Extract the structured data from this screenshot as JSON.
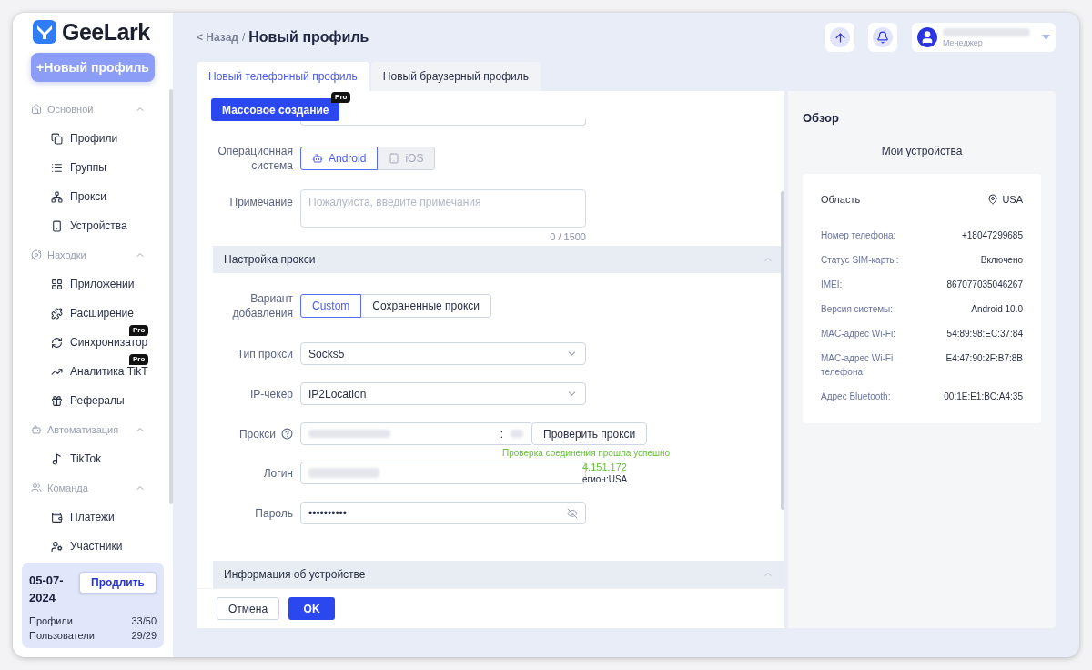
{
  "logo": {
    "text": "GeeLark"
  },
  "new_profile_button": "+Новый профиль",
  "sidebar": {
    "groups": [
      {
        "title": "Основной",
        "expanded": true,
        "items": [
          {
            "label": "Профили"
          },
          {
            "label": "Группы"
          },
          {
            "label": "Прокси"
          },
          {
            "label": "Устройства"
          }
        ]
      },
      {
        "title": "Находки",
        "expanded": true,
        "items": [
          {
            "label": "Приложении"
          },
          {
            "label": "Расширение"
          },
          {
            "label": "Синхронизатор",
            "badge": "Pro"
          },
          {
            "label": "Аналитика TikT",
            "badge": "Pro"
          },
          {
            "label": "Рефералы"
          }
        ]
      },
      {
        "title": "Автоматизация",
        "expanded": true,
        "items": [
          {
            "label": "TikTok"
          }
        ]
      },
      {
        "title": "Команда",
        "expanded": true,
        "items": [
          {
            "label": "Платежи"
          },
          {
            "label": "Участники"
          }
        ]
      }
    ]
  },
  "plan": {
    "date": "05-07-2024",
    "renew_button": "Продлить",
    "stats": [
      {
        "label": "Профили",
        "value": "33/50"
      },
      {
        "label": "Пользователи",
        "value": "29/29"
      }
    ]
  },
  "header": {
    "back": "< Назад",
    "separator": "/",
    "title": "Новый профиль",
    "user_role": "Менеджер"
  },
  "tabs": [
    {
      "label": "Новый телефонный профиль",
      "selected": true
    },
    {
      "label": "Новый браузерный профиль",
      "selected": false
    }
  ],
  "form": {
    "mass_create_button": "Массовое создание",
    "mass_create_badge": "Pro",
    "os": {
      "label": "Операционная система",
      "options": [
        {
          "label": "Android",
          "selected": true,
          "disabled": false
        },
        {
          "label": "iOS",
          "selected": false,
          "disabled": true
        }
      ]
    },
    "note": {
      "label": "Примечание",
      "placeholder": "Пожалуйста, введите примечания",
      "counter": "0 / 1500"
    },
    "proxy_section": {
      "title": "Настройка прокси",
      "expanded": true
    },
    "add_variant": {
      "label": "Вариант добавления",
      "options": [
        {
          "label": "Custom",
          "selected": true
        },
        {
          "label": "Сохраненные прокси",
          "selected": false
        }
      ]
    },
    "proxy_type": {
      "label": "Тип прокси",
      "value": "Socks5"
    },
    "ip_checker": {
      "label": "IP-чекер",
      "value": "IP2Location"
    },
    "proxy": {
      "label": "Прокси",
      "separator": ":",
      "check_button": "Проверить прокси",
      "success": "Проверка соединения прошла успешно",
      "ip": "4.151.172",
      "region": "егион:USA"
    },
    "login": {
      "label": "Логин"
    },
    "password": {
      "label": "Пароль",
      "value": "••••••••••"
    },
    "device_section": {
      "title": "Информация об устройстве",
      "expanded": true
    }
  },
  "footer": {
    "cancel": "Отмена",
    "ok": "OK"
  },
  "overview": {
    "title": "Обзор",
    "subtitle": "Мои устройства",
    "region_label": "Область",
    "region_value": "USA",
    "rows": [
      {
        "label": "Номер телефона:",
        "value": "+18047299685"
      },
      {
        "label": "Статус SIM-карты:",
        "value": "Включено"
      },
      {
        "label": "IMEI:",
        "value": "867077035046267"
      },
      {
        "label": "Версия системы:",
        "value": "Android 10.0"
      },
      {
        "label": "MAC-адрес Wi-Fi:",
        "value": "54:89:98:EC:37:84"
      },
      {
        "label": "MAC-адрес Wi-Fi телефона:",
        "value": "E4:47:90:2F:B7:8B"
      },
      {
        "label": "Адрес Bluetooth:",
        "value": "00:1E:E1:BC:A4:35"
      }
    ]
  }
}
